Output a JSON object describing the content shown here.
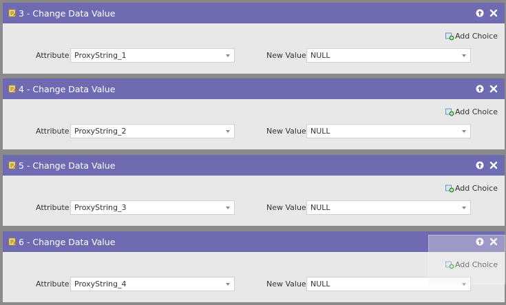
{
  "steps": [
    {
      "title": "3 - Change Data Value",
      "add_choice": "Add Choice",
      "attribute_label": "Attribute:",
      "attribute_value": "ProxyString_1",
      "new_value_label": "New Value:",
      "new_value": "NULL"
    },
    {
      "title": "4 - Change Data Value",
      "add_choice": "Add Choice",
      "attribute_label": "Attribute:",
      "attribute_value": "ProxyString_2",
      "new_value_label": "New Value:",
      "new_value": "NULL"
    },
    {
      "title": "5 - Change Data Value",
      "add_choice": "Add Choice",
      "attribute_label": "Attribute:",
      "attribute_value": "ProxyString_3",
      "new_value_label": "New Value:",
      "new_value": "NULL"
    },
    {
      "title": "6 - Change Data Value",
      "add_choice": "Add Choice",
      "attribute_label": "Attribute:",
      "attribute_value": "ProxyString_4",
      "new_value_label": "New Value:",
      "new_value": "NULL"
    }
  ],
  "colors": {
    "header": "#6f6bb3",
    "panel": "#e8e8e8",
    "background": "#8a8a8a"
  },
  "icons": {
    "step": "flow-step-icon",
    "collapse": "arrow-up-circle-icon",
    "close": "close-icon",
    "add": "add-choice-icon"
  }
}
